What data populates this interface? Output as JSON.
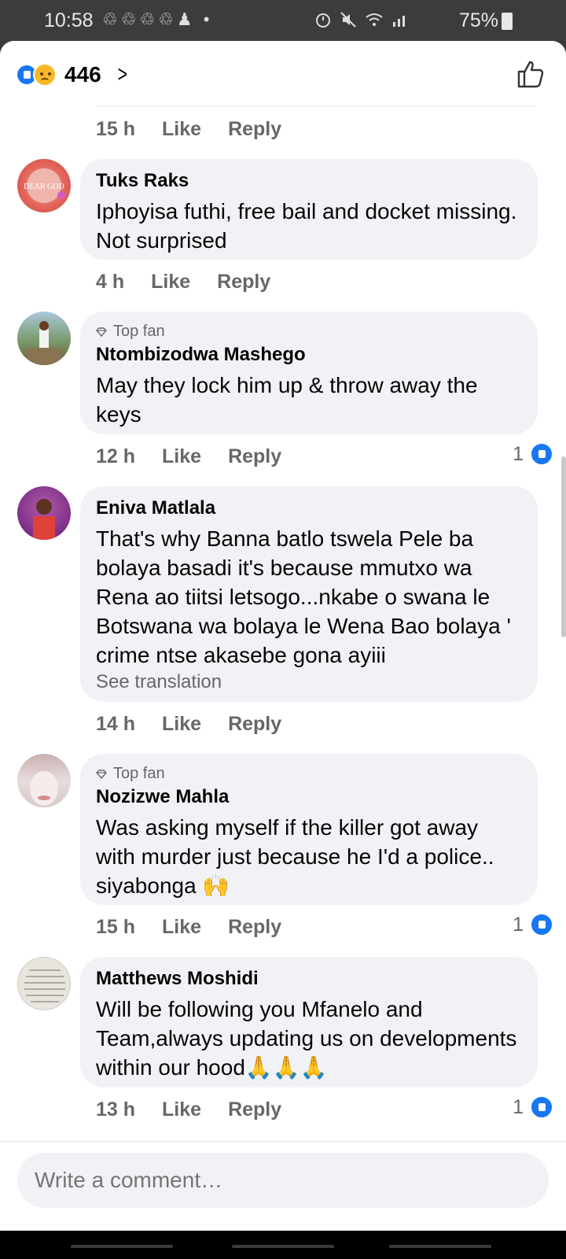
{
  "status": {
    "time": "10:58",
    "notif_icons": "♲♲♲♲♟ •",
    "battery": "75%"
  },
  "header": {
    "reaction_count": "446"
  },
  "top_comment": {
    "time": "15 h",
    "like_label": "Like",
    "reply_label": "Reply"
  },
  "comments": [
    {
      "name": "Tuks Raks",
      "badge": "",
      "text": "Iphoyisa futhi, free bail and docket missing. Not surprised",
      "time": "4 h",
      "like_label": "Like",
      "reply_label": "Reply",
      "likes": ""
    },
    {
      "name": "Ntombizodwa Mashego",
      "badge": "Top fan",
      "text": "May they lock him up & throw away the keys",
      "time": "12 h",
      "like_label": "Like",
      "reply_label": "Reply",
      "likes": "1"
    },
    {
      "name": "Eniva Matlala",
      "badge": "",
      "text": "That's why Banna batlo tswela Pele ba bolaya basadi it's because mmutxo wa Rena ao tiitsi letsogo...nkabe o swana le Botswana wa bolaya le Wena Bao bolaya ' crime ntse akasebe gona ayiii",
      "see_translation": "See translation",
      "time": "14 h",
      "like_label": "Like",
      "reply_label": "Reply",
      "likes": ""
    },
    {
      "name": "Nozizwe Mahla",
      "badge": "Top fan",
      "text": "Was asking myself if the killer got away with murder just because he I'd a police.. siyabonga 🙌",
      "time": "15 h",
      "like_label": "Like",
      "reply_label": "Reply",
      "likes": "1"
    },
    {
      "name": "Matthews Moshidi",
      "badge": "",
      "text": "Will be following you Mfanelo and Team,always updating us on developments within our hood🙏🙏🙏",
      "time": "13 h",
      "like_label": "Like",
      "reply_label": "Reply",
      "likes": "1"
    }
  ],
  "composer": {
    "placeholder": "Write a comment…"
  },
  "colors": {
    "accent": "#1877f2",
    "bubble": "#f0f2f5",
    "meta": "#65676b"
  }
}
